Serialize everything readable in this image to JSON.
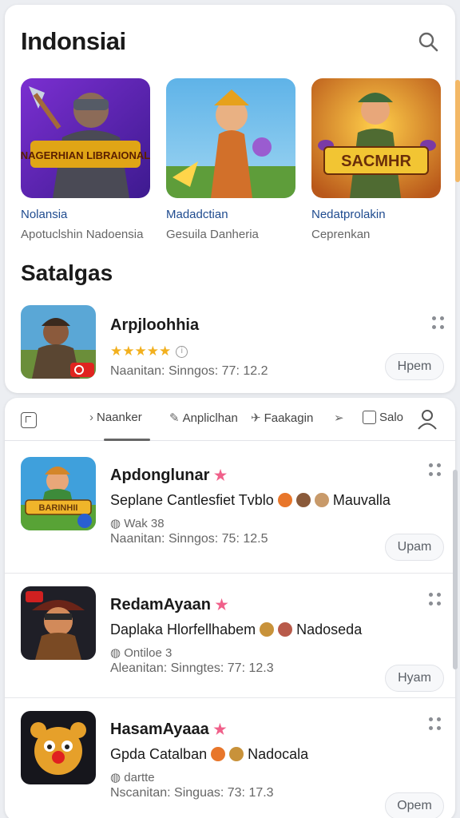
{
  "header": {
    "title": "Indonsiai"
  },
  "featured": [
    {
      "name": "Nolansia",
      "sub": "Apotuclshin Nadoensia",
      "art_text": "NAGERHIAN LIBRAIONAL"
    },
    {
      "name": "Madadctian",
      "sub": "Gesuila Danheria",
      "art_text": ""
    },
    {
      "name": "Nedatprolakin",
      "sub": "Ceprenkan",
      "art_text": "SACMHR"
    }
  ],
  "section": {
    "title": "Satalgas"
  },
  "spotlight": {
    "title": "Arpjloohhia",
    "stars": "★★★★★",
    "info": "Naanitan: Sinngos: 77: 12.2",
    "open": "Hpem"
  },
  "tabs": [
    {
      "label": "Naanker",
      "active": true
    },
    {
      "label": "Anpliclhan",
      "active": false
    },
    {
      "label": "Faakagin",
      "active": false
    },
    {
      "label": "Salo",
      "active": false
    }
  ],
  "list": [
    {
      "title": "Apdonglunar",
      "desc_left": "Seplane Cantlesfiet Tvblo",
      "desc_right": "Mauvalla",
      "meta": "Wak 38",
      "info": "Naanitan: Sinngos: 75: 12.5",
      "open": "Upam",
      "art_text": "BARINHII"
    },
    {
      "title": "RedamAyaan",
      "desc_left": "Daplaka Hlorfellhabem",
      "desc_right": "Nadoseda",
      "meta": "Ontiloe 3",
      "info": "Aleanitan: Sinngtes: 77: 12.3",
      "open": "Hyam",
      "art_text": ""
    },
    {
      "title": "HasamAyaaa",
      "desc_left": "Gpda Catalban",
      "desc_right": "Nadocala",
      "meta": "dartte",
      "info": "Nscanitan: Singuas: 73: 17.3",
      "open": "Opem",
      "art_text": ""
    }
  ],
  "colors": {
    "accent_blue": "#1f4b8f",
    "star_gold": "#f2b01e",
    "pink_star": "#f0608a"
  }
}
